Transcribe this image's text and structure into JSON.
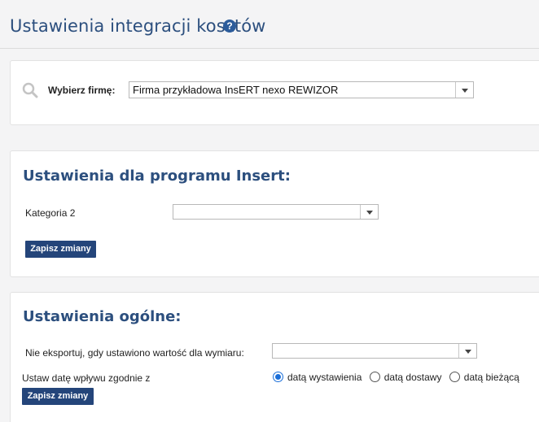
{
  "header": {
    "title": "Ustawienia integracji kosztów",
    "help_icon": "?"
  },
  "company": {
    "label": "Wybierz firmę:",
    "selected": "Firma przykładowa InsERT nexo REWIZOR"
  },
  "insert_settings": {
    "title": "Ustawienia dla programu Insert:",
    "category_label": "Kategoria 2",
    "category_value": "",
    "save_label": "Zapisz zmiany"
  },
  "general_settings": {
    "title": "Ustawienia ogólne:",
    "dimension_label": "Nie eksportuj, gdy ustawiono wartość dla wymiaru:",
    "dimension_value": "",
    "date_label": "Ustaw datę wpływu zgodnie z",
    "date_options": [
      {
        "label": "datą wystawienia",
        "checked": true
      },
      {
        "label": "datą dostawy",
        "checked": false
      },
      {
        "label": "datą bieżącą",
        "checked": false
      }
    ],
    "save_label": "Zapisz zmiany"
  },
  "colors": {
    "accent": "#2c4f7e",
    "button": "#24457a",
    "radio": "#1a6ed8"
  }
}
